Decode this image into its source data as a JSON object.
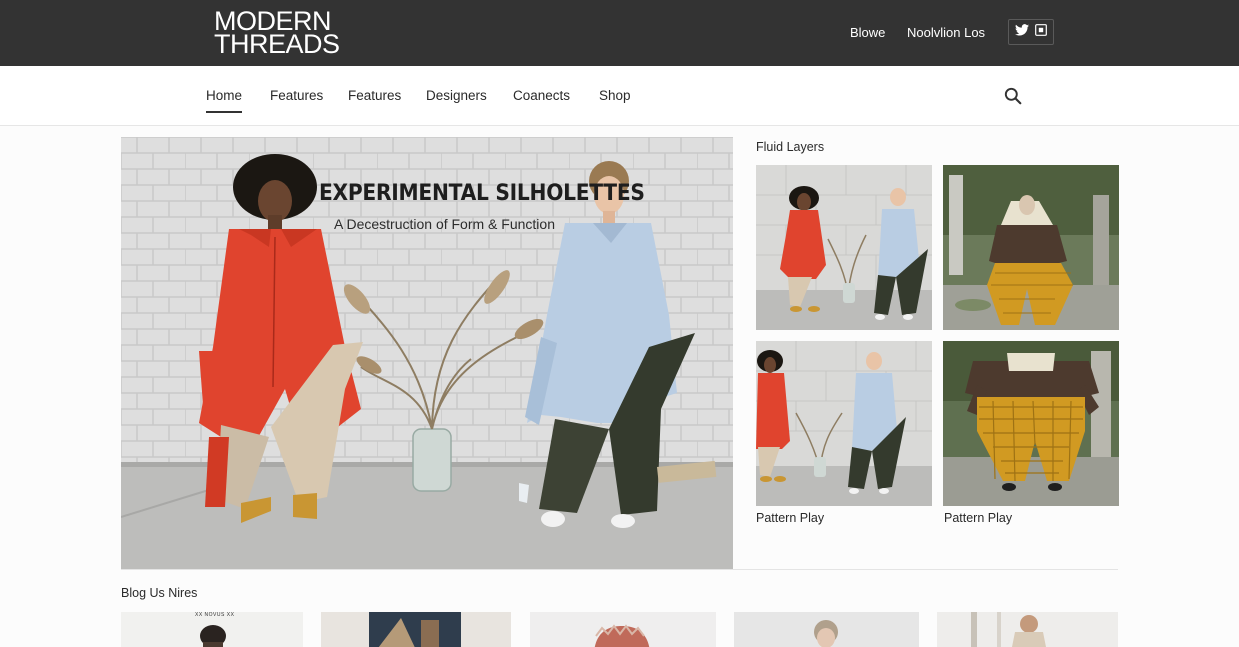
{
  "brand": {
    "line1": "MODERN",
    "line2": "THREADS"
  },
  "topbar": {
    "links": [
      "Blowe",
      "Noolvlion Los"
    ],
    "social_icons": [
      "twitter-icon",
      "instagram-icon"
    ]
  },
  "nav": {
    "items": [
      "Home",
      "Features",
      "Features",
      "Designers",
      "Coanects",
      "Shop"
    ],
    "active": "Home",
    "search_icon": "search-icon"
  },
  "hero": {
    "title": "EXPERIMENTAL SILHOLETTES",
    "subtitle": "A Decestruction of Form & Function"
  },
  "side": {
    "title": "Fluid Layers",
    "captions": [
      "Pattern Play",
      "Pattern Play"
    ]
  },
  "blog": {
    "title": "Blog Us Nires",
    "card_count": 5,
    "tiny_text": "XX NOVUS XX"
  },
  "colors": {
    "topbar": "#333333",
    "red_shirt": "#e0442e",
    "blue_shirt": "#b9cde3",
    "mustard": "#d19a22"
  }
}
